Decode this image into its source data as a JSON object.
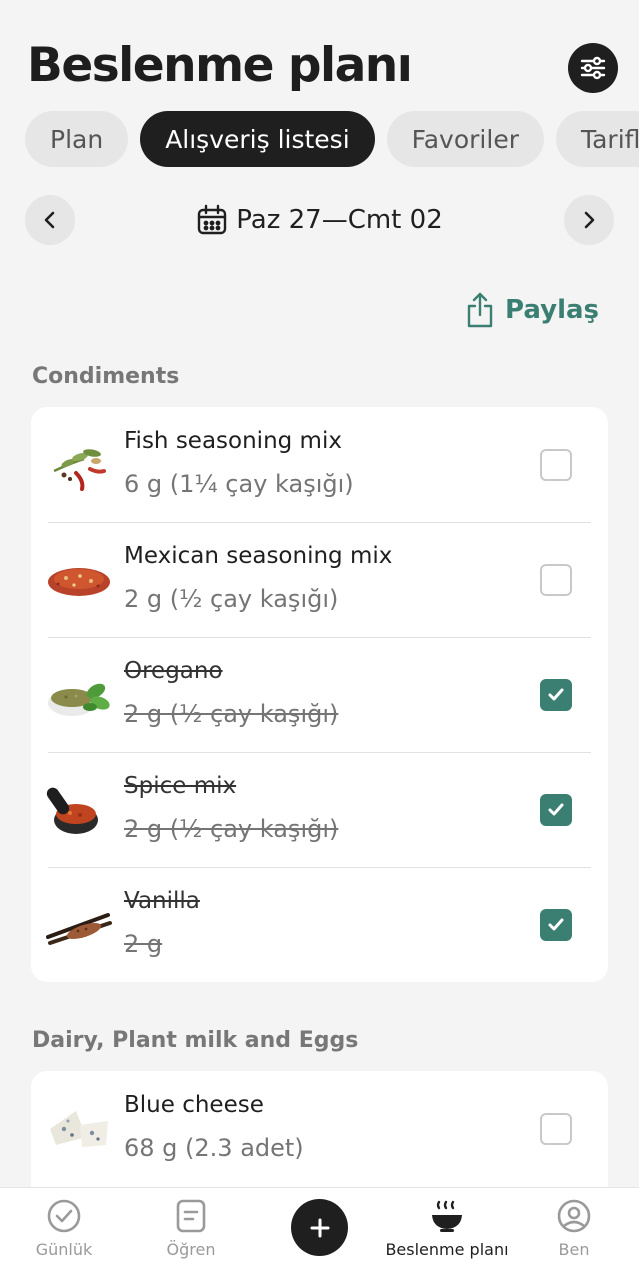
{
  "header": {
    "title": "Beslenme planı",
    "settings_icon": "sliders-icon"
  },
  "tabs": [
    {
      "label": "Plan"
    },
    {
      "label": "Alışveriş listesi",
      "active": true
    },
    {
      "label": "Favoriler"
    },
    {
      "label": "Tarifler"
    }
  ],
  "week": {
    "range": "Paz 27—Cmt 02",
    "icon": "calendar-icon"
  },
  "share": {
    "label": "Paylaş",
    "icon": "share-icon"
  },
  "sections": [
    {
      "title": "Condiments",
      "items": [
        {
          "name": "Fish seasoning mix",
          "qty": "6 g (1¼ çay kaşığı)",
          "checked": false
        },
        {
          "name": "Mexican seasoning mix",
          "qty": "2 g (½ çay kaşığı)",
          "checked": false
        },
        {
          "name": "Oregano",
          "qty": "2 g (½ çay kaşığı)",
          "checked": true
        },
        {
          "name": "Spice mix",
          "qty": "2 g (½ çay kaşığı)",
          "checked": true
        },
        {
          "name": "Vanilla",
          "qty": "2 g",
          "checked": true
        }
      ]
    },
    {
      "title": "Dairy, Plant milk and Eggs",
      "items": [
        {
          "name": "Blue cheese",
          "qty": "68 g (2.3 adet)",
          "checked": false
        }
      ]
    }
  ],
  "tabbar": [
    {
      "label": "Günlük",
      "icon": "check-circle-icon"
    },
    {
      "label": "Öğren",
      "icon": "document-icon"
    },
    {
      "label": "",
      "icon": "plus-icon"
    },
    {
      "label": "Beslenme planı",
      "icon": "meal-bowl-icon",
      "active": true
    },
    {
      "label": "Ben",
      "icon": "profile-icon"
    }
  ],
  "colors": {
    "accent": "#3a7f72",
    "dark": "#1f1f1f",
    "background": "#f4f4f4"
  }
}
